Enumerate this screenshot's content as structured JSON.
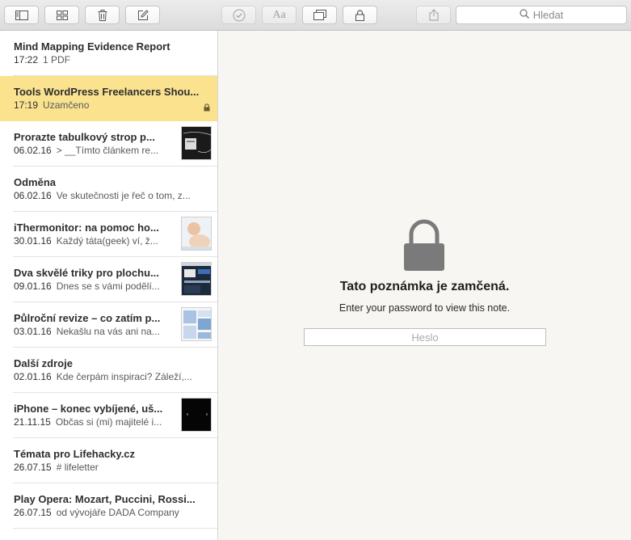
{
  "toolbar": {
    "search_placeholder": "Hledat",
    "buttons": [
      "sidebar-toggle-icon",
      "gallery-icon",
      "trash-icon",
      "compose-icon",
      "checklist-icon",
      "format-icon",
      "attachments-icon",
      "lock-icon",
      "share-icon"
    ]
  },
  "notes": [
    {
      "title": "Mind Mapping Evidence Report",
      "time": "17:22",
      "preview": "1 PDF",
      "selected": false,
      "locked": false,
      "thumb": ""
    },
    {
      "title": "Tools WordPress Freelancers Shou...",
      "time": "17:19",
      "preview": "Uzamčeno",
      "selected": true,
      "locked": true,
      "thumb": ""
    },
    {
      "title": "Prorazte tabulkový strop p...",
      "time": "06.02.16",
      "preview": "> __Tímto článkem re...",
      "selected": false,
      "locked": false,
      "thumb": "dark"
    },
    {
      "title": "Odměna",
      "time": "06.02.16",
      "preview": "Ve skutečnosti je řeč o tom, z...",
      "selected": false,
      "locked": false,
      "thumb": ""
    },
    {
      "title": "iThermonitor: na pomoc ho...",
      "time": "30.01.16",
      "preview": "Každý táta(geek) ví, ž...",
      "selected": false,
      "locked": false,
      "thumb": "baby"
    },
    {
      "title": "Dva skvělé triky pro plochu...",
      "time": "09.01.16",
      "preview": "Dnes se s vámi podělí...",
      "selected": false,
      "locked": false,
      "thumb": "screen"
    },
    {
      "title": "Půlroční revize – co zatím p...",
      "time": "03.01.16",
      "preview": "Nekašlu na vás ani na...",
      "selected": false,
      "locked": false,
      "thumb": "map"
    },
    {
      "title": "Další zdroje",
      "time": "02.01.16",
      "preview": "Kde čerpám inspiraci? Záleží,...",
      "selected": false,
      "locked": false,
      "thumb": ""
    },
    {
      "title": "iPhone – konec vybíjené, uš...",
      "time": "21.11.15",
      "preview": "Občas si (mi) majitelé i...",
      "selected": false,
      "locked": false,
      "thumb": "black"
    },
    {
      "title": "Témata pro Lifehacky.cz",
      "time": "26.07.15",
      "preview": "# lifeletter",
      "selected": false,
      "locked": false,
      "thumb": ""
    },
    {
      "title": "Play Opera: Mozart, Puccini, Rossi...",
      "time": "26.07.15",
      "preview": "od vývojáře DADA Company",
      "selected": false,
      "locked": false,
      "thumb": ""
    }
  ],
  "locked_view": {
    "title": "Tato poznámka je zamčená.",
    "subtitle": "Enter your password to view this note.",
    "password_placeholder": "Heslo"
  },
  "colors": {
    "selected_row": "#fae28f",
    "lock_icon": "#7a7a7a",
    "content_bg": "#f7f6f3"
  }
}
